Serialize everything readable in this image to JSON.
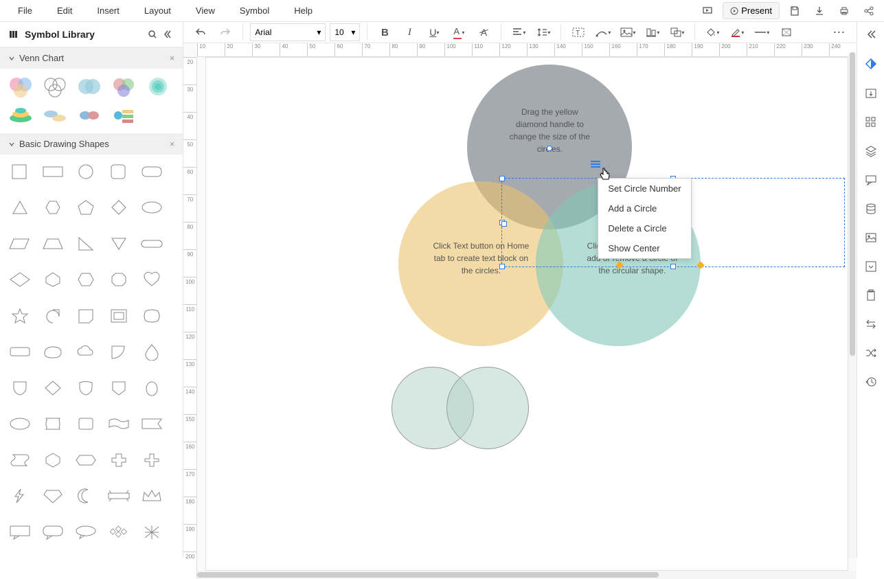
{
  "menu": {
    "items": [
      "File",
      "Edit",
      "Insert",
      "Layout",
      "View",
      "Symbol",
      "Help"
    ],
    "present": "Present"
  },
  "sidebar": {
    "title": "Symbol Library",
    "categories": {
      "venn": "Venn Chart",
      "basic": "Basic Drawing Shapes"
    }
  },
  "toolbar": {
    "font": "Arial",
    "size": "10"
  },
  "canvas": {
    "text_gray": "Drag the yellow diamond handle to change the size of the circles.",
    "text_yellow": "Click Text button on Home tab to create text block on the circles.",
    "text_teal": "Click the action button to add or remove a circle of the circular shape."
  },
  "context_menu": {
    "items": [
      "Set Circle Number",
      "Add a Circle",
      "Delete a Circle",
      "Show Center"
    ]
  },
  "ruler_h": [
    10,
    20,
    30,
    40,
    50,
    60,
    70,
    80,
    90,
    100,
    110,
    120,
    130,
    140,
    150,
    160,
    170,
    180,
    190,
    200,
    210,
    220,
    230,
    240
  ],
  "ruler_v": [
    20,
    30,
    40,
    50,
    60,
    70,
    80,
    90,
    100,
    110,
    120,
    130,
    140,
    150,
    160,
    170,
    180,
    190,
    200
  ]
}
